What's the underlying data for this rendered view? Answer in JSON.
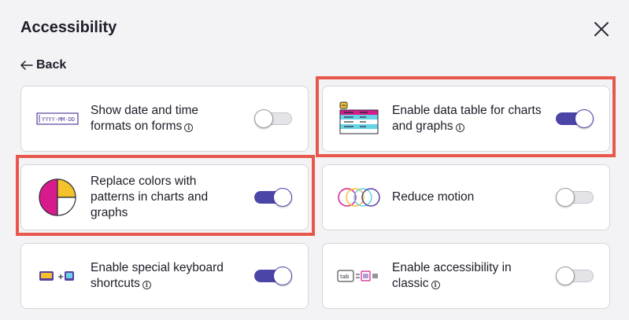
{
  "dialog": {
    "title": "Accessibility",
    "back_label": "Back",
    "close_icon": "close-icon"
  },
  "settings": [
    {
      "label": "Show date and time formats on forms",
      "has_info": true,
      "enabled": false,
      "icon": "date-format-icon",
      "date_format": "YYYY-MM-DD"
    },
    {
      "label": "Enable data table for charts and graphs",
      "has_info": true,
      "enabled": true,
      "icon": "data-table-icon",
      "highlighted": true
    },
    {
      "label": "Replace colors with patterns in charts and graphs",
      "has_info": false,
      "enabled": true,
      "icon": "pie-pattern-icon",
      "highlighted": true
    },
    {
      "label": "Reduce motion",
      "has_info": false,
      "enabled": false,
      "icon": "motion-circles-icon"
    },
    {
      "label": "Enable special keyboard shortcuts",
      "has_info": true,
      "enabled": true,
      "icon": "keyboard-shortcut-icon"
    },
    {
      "label": "Enable accessibility in classic",
      "has_info": true,
      "enabled": false,
      "icon": "classic-tab-icon",
      "tab_text": "tab"
    }
  ],
  "colors": {
    "toggle_on": "#4b45a8",
    "toggle_off": "#e4e4e8",
    "highlight": "#e8574c",
    "pink": "#d81b8c",
    "yellow": "#f3c22c",
    "cyan": "#67d3e6",
    "purple": "#5a3fa0"
  }
}
